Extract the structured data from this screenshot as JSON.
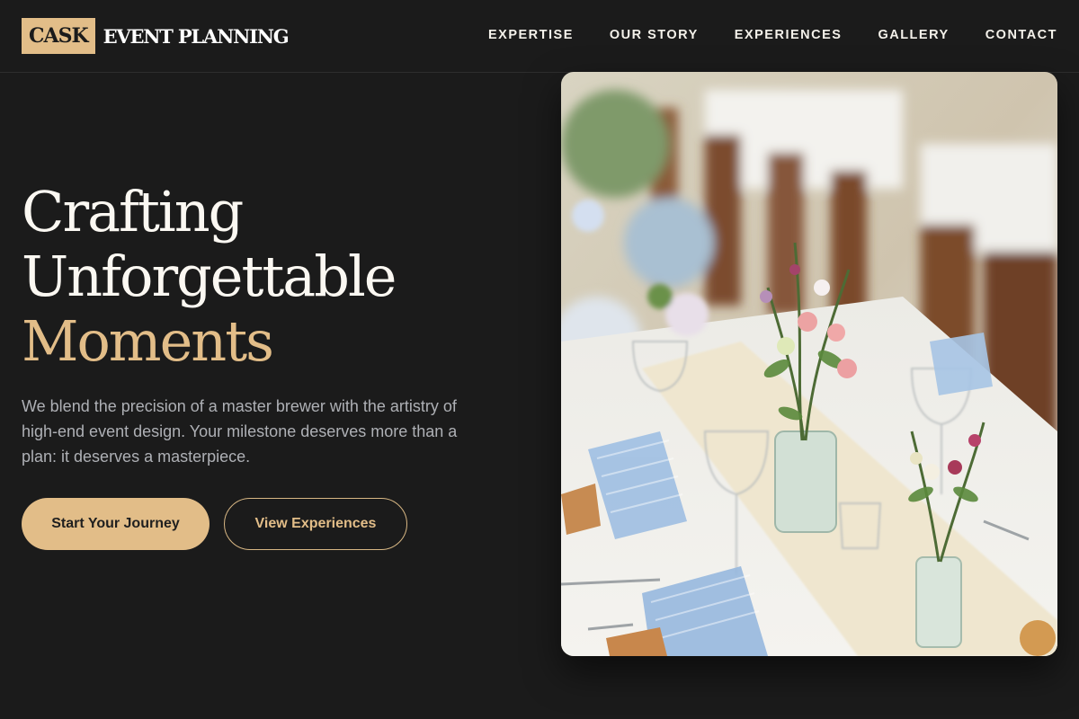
{
  "brand": {
    "box": "CASK",
    "name": "EVENT PLANNING"
  },
  "nav": [
    "EXPERTISE",
    "OUR STORY",
    "EXPERIENCES",
    "GALLERY",
    "CONTACT"
  ],
  "hero": {
    "headline_line1": "Crafting",
    "headline_line2": "Unforgettable",
    "headline_accent": "Moments",
    "intro": "We blend the precision of a master brewer with the artistry of high-end event design. Your milestone deserves more than a plan: it deserves a masterpiece.",
    "primary_cta": "Start Your Journey",
    "secondary_cta": "View Experiences"
  },
  "colors": {
    "background": "#1b1b1b",
    "accent": "#e2bd88",
    "text": "#fbf8f2",
    "muted": "#aeb0b5"
  },
  "photo": {
    "subject": "banquet table with floral centerpieces, glassware and gingham napkins"
  }
}
